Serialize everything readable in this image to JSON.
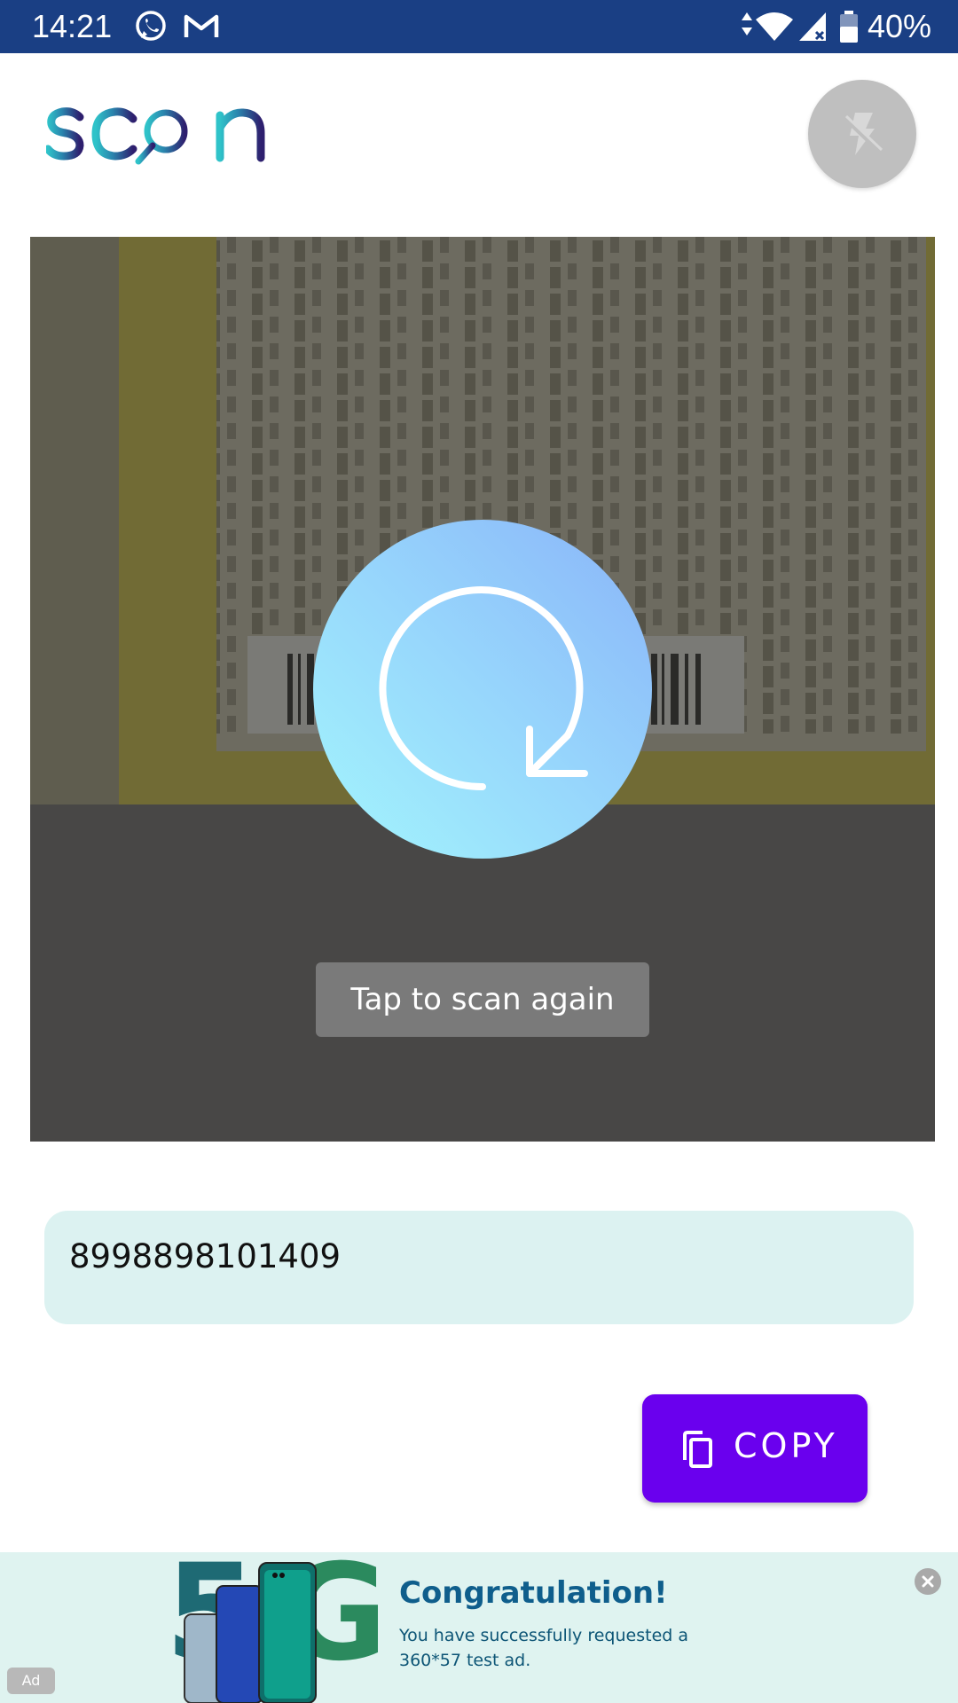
{
  "status_bar": {
    "time": "14:21",
    "battery_percent": "40%",
    "icons": [
      "whatsapp-icon",
      "gmail-icon",
      "data-arrows-icon",
      "wifi-icon",
      "signal-icon",
      "battery-icon"
    ],
    "background_color": "#1a3f84"
  },
  "header": {
    "logo_text": "scan",
    "flash_icon": "flash-off-icon"
  },
  "scanner": {
    "rescan_icon": "rotate-cw-icon",
    "scan_again_label": "Tap to scan again"
  },
  "result": {
    "value": "8998898101409"
  },
  "actions": {
    "copy_label": "COPY",
    "copy_icon": "copy-icon",
    "accent_color": "#6a00ee"
  },
  "ad": {
    "title": "Congratulation!",
    "body": "You have successfully requested a 360*57 test ad.",
    "tag": "Ad",
    "close_icon": "close-icon"
  }
}
